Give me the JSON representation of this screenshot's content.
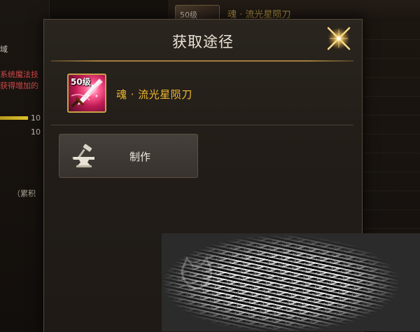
{
  "background": {
    "left_text_1": "域",
    "left_text_2": "系统魔法技",
    "left_text_3": "获得增加的",
    "left_num_1": "10",
    "left_num_2": "10",
    "left_text_4": "（累积",
    "top_badge": "50级",
    "top_title": "魂 · 流光星陨刀"
  },
  "modal": {
    "title": "获取途径",
    "close_icon": "close-star-icon"
  },
  "item": {
    "level": "50级",
    "name": "魂 · 流光星陨刀",
    "icon": "sword-icon"
  },
  "sources": [
    {
      "label": "制作",
      "icon": "anvil-hammer-icon"
    }
  ],
  "colors": {
    "title": "#ece4d7",
    "item_name": "#f1b92c",
    "divider_gold": "#a07d3a",
    "button_bg": "#3e3934"
  }
}
